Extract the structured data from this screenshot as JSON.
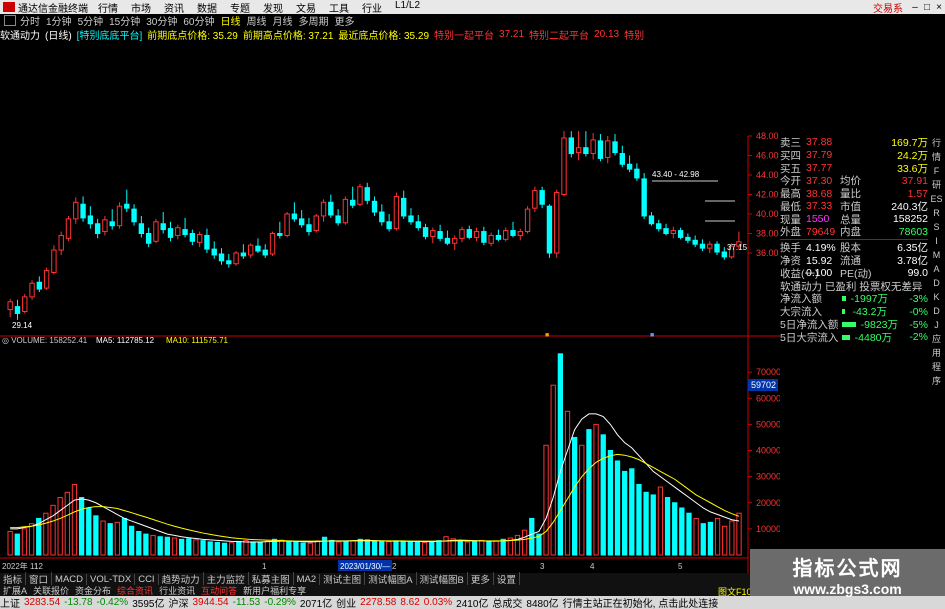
{
  "window": {
    "title": "通达信金融终端",
    "login": "交易系",
    "menu": [
      "行情",
      "市场",
      "资讯",
      "数据",
      "专题",
      "发现",
      "文易",
      "工具",
      "行业",
      "L1/L2"
    ]
  },
  "toolbar": {
    "periods": [
      "分时",
      "1分钟",
      "5分钟",
      "15分钟",
      "30分钟",
      "60分钟",
      "日线",
      "周线",
      "月线",
      "多周期",
      "更多"
    ],
    "active": "日线"
  },
  "infobar": {
    "name": "软通动力",
    "period_note": "(日线)",
    "items": [
      {
        "text": "[特别底底平台]",
        "color": "cyan"
      },
      {
        "text": "前期底点价格: 35.29",
        "color": "yellow"
      },
      {
        "text": "前期高点价格: 37.21",
        "color": "yellow"
      },
      {
        "text": "最近底点价格: 35.29",
        "color": "yellow"
      },
      {
        "text": "特别一起平台",
        "color": "red"
      },
      {
        "text": "37.21",
        "color": "red"
      },
      {
        "text": "特别二起平台",
        "color": "red"
      },
      {
        "text": "20.13",
        "color": "red"
      },
      {
        "text": "特别",
        "color": "red"
      }
    ]
  },
  "price_chart": {
    "ymin": 28,
    "ymax": 48,
    "y_ticks": [
      48.0,
      46.0,
      44.0,
      42.0,
      40.0,
      38.0,
      36.0
    ],
    "low_label": "29.14",
    "range_label": "43.40 - 42.98",
    "last_label": "37.15",
    "candles": [
      {
        "o": 30.2,
        "h": 31.3,
        "l": 29.4,
        "c": 31.0
      },
      {
        "o": 30.5,
        "h": 31.2,
        "l": 29.14,
        "c": 29.8
      },
      {
        "o": 30.0,
        "h": 31.8,
        "l": 29.8,
        "c": 31.5
      },
      {
        "o": 31.5,
        "h": 33.2,
        "l": 31.2,
        "c": 32.9
      },
      {
        "o": 33.0,
        "h": 33.6,
        "l": 32.0,
        "c": 32.3
      },
      {
        "o": 32.4,
        "h": 34.5,
        "l": 32.2,
        "c": 34.2
      },
      {
        "o": 34.0,
        "h": 36.8,
        "l": 33.8,
        "c": 36.3
      },
      {
        "o": 36.3,
        "h": 38.2,
        "l": 35.8,
        "c": 37.8
      },
      {
        "o": 37.5,
        "h": 39.8,
        "l": 37.2,
        "c": 39.5
      },
      {
        "o": 39.5,
        "h": 41.7,
        "l": 39.0,
        "c": 41.2
      },
      {
        "o": 41.0,
        "h": 41.8,
        "l": 39.2,
        "c": 39.6
      },
      {
        "o": 39.8,
        "h": 40.8,
        "l": 38.5,
        "c": 39.0
      },
      {
        "o": 39.0,
        "h": 39.5,
        "l": 37.5,
        "c": 38.0
      },
      {
        "o": 38.2,
        "h": 39.8,
        "l": 37.8,
        "c": 39.4
      },
      {
        "o": 39.2,
        "h": 40.5,
        "l": 38.4,
        "c": 38.8
      },
      {
        "o": 38.8,
        "h": 41.2,
        "l": 38.5,
        "c": 40.8
      },
      {
        "o": 41.0,
        "h": 42.5,
        "l": 40.2,
        "c": 40.6
      },
      {
        "o": 40.5,
        "h": 41.0,
        "l": 38.8,
        "c": 39.2
      },
      {
        "o": 39.0,
        "h": 39.8,
        "l": 37.6,
        "c": 38.0
      },
      {
        "o": 38.0,
        "h": 38.6,
        "l": 36.6,
        "c": 37.0
      },
      {
        "o": 37.2,
        "h": 39.5,
        "l": 37.0,
        "c": 39.2
      },
      {
        "o": 39.0,
        "h": 40.2,
        "l": 38.0,
        "c": 38.4
      },
      {
        "o": 38.5,
        "h": 39.2,
        "l": 37.2,
        "c": 37.6
      },
      {
        "o": 37.8,
        "h": 38.9,
        "l": 37.4,
        "c": 38.6
      },
      {
        "o": 38.4,
        "h": 39.6,
        "l": 37.6,
        "c": 37.9
      },
      {
        "o": 38.0,
        "h": 38.4,
        "l": 36.8,
        "c": 37.2
      },
      {
        "o": 37.1,
        "h": 38.2,
        "l": 36.6,
        "c": 37.9
      },
      {
        "o": 37.8,
        "h": 38.5,
        "l": 36.0,
        "c": 36.4
      },
      {
        "o": 36.4,
        "h": 37.2,
        "l": 35.4,
        "c": 35.8
      },
      {
        "o": 35.9,
        "h": 36.5,
        "l": 34.8,
        "c": 35.2
      },
      {
        "o": 35.2,
        "h": 35.9,
        "l": 34.5,
        "c": 34.9
      },
      {
        "o": 34.9,
        "h": 36.2,
        "l": 34.7,
        "c": 36.0
      },
      {
        "o": 36.0,
        "h": 36.9,
        "l": 35.4,
        "c": 35.7
      },
      {
        "o": 35.8,
        "h": 37.0,
        "l": 35.5,
        "c": 36.8
      },
      {
        "o": 36.7,
        "h": 37.5,
        "l": 36.0,
        "c": 36.2
      },
      {
        "o": 36.3,
        "h": 36.9,
        "l": 35.5,
        "c": 35.8
      },
      {
        "o": 35.9,
        "h": 38.2,
        "l": 35.7,
        "c": 38.0
      },
      {
        "o": 38.0,
        "h": 39.2,
        "l": 37.5,
        "c": 37.8
      },
      {
        "o": 37.8,
        "h": 40.2,
        "l": 37.6,
        "c": 40.0
      },
      {
        "o": 40.0,
        "h": 41.2,
        "l": 39.2,
        "c": 39.5
      },
      {
        "o": 39.5,
        "h": 40.4,
        "l": 38.6,
        "c": 38.9
      },
      {
        "o": 38.9,
        "h": 39.6,
        "l": 37.8,
        "c": 38.2
      },
      {
        "o": 38.3,
        "h": 40.0,
        "l": 38.1,
        "c": 39.8
      },
      {
        "o": 39.8,
        "h": 41.5,
        "l": 39.2,
        "c": 41.2
      },
      {
        "o": 41.2,
        "h": 42.0,
        "l": 39.6,
        "c": 39.9
      },
      {
        "o": 39.8,
        "h": 40.5,
        "l": 38.8,
        "c": 39.1
      },
      {
        "o": 39.1,
        "h": 41.8,
        "l": 38.9,
        "c": 41.5
      },
      {
        "o": 41.4,
        "h": 42.8,
        "l": 40.6,
        "c": 40.9
      },
      {
        "o": 41.0,
        "h": 43.1,
        "l": 40.8,
        "c": 42.8
      },
      {
        "o": 42.7,
        "h": 43.2,
        "l": 41.0,
        "c": 41.4
      },
      {
        "o": 41.3,
        "h": 41.8,
        "l": 39.8,
        "c": 40.2
      },
      {
        "o": 40.2,
        "h": 41.0,
        "l": 38.8,
        "c": 39.2
      },
      {
        "o": 39.2,
        "h": 40.0,
        "l": 38.2,
        "c": 38.5
      },
      {
        "o": 38.5,
        "h": 42.2,
        "l": 38.3,
        "c": 41.8
      },
      {
        "o": 41.6,
        "h": 42.4,
        "l": 39.5,
        "c": 39.8
      },
      {
        "o": 39.8,
        "h": 40.6,
        "l": 38.9,
        "c": 39.2
      },
      {
        "o": 39.2,
        "h": 39.9,
        "l": 38.3,
        "c": 38.6
      },
      {
        "o": 38.6,
        "h": 39.0,
        "l": 37.4,
        "c": 37.7
      },
      {
        "o": 37.7,
        "h": 38.6,
        "l": 37.0,
        "c": 38.3
      },
      {
        "o": 38.2,
        "h": 38.9,
        "l": 37.2,
        "c": 37.5
      },
      {
        "o": 37.5,
        "h": 38.3,
        "l": 36.8,
        "c": 37.0
      },
      {
        "o": 37.0,
        "h": 37.8,
        "l": 36.3,
        "c": 37.5
      },
      {
        "o": 37.5,
        "h": 38.7,
        "l": 37.1,
        "c": 38.4
      },
      {
        "o": 38.4,
        "h": 38.8,
        "l": 37.4,
        "c": 37.6
      },
      {
        "o": 37.6,
        "h": 38.6,
        "l": 37.2,
        "c": 38.2
      },
      {
        "o": 38.2,
        "h": 38.7,
        "l": 36.8,
        "c": 37.1
      },
      {
        "o": 37.0,
        "h": 38.1,
        "l": 36.7,
        "c": 37.8
      },
      {
        "o": 37.8,
        "h": 38.4,
        "l": 37.2,
        "c": 37.4
      },
      {
        "o": 37.4,
        "h": 38.6,
        "l": 37.2,
        "c": 38.3
      },
      {
        "o": 38.3,
        "h": 39.2,
        "l": 37.6,
        "c": 37.8
      },
      {
        "o": 37.8,
        "h": 38.5,
        "l": 37.3,
        "c": 38.2
      },
      {
        "o": 38.2,
        "h": 40.8,
        "l": 38.0,
        "c": 40.5
      },
      {
        "o": 40.6,
        "h": 42.8,
        "l": 40.2,
        "c": 42.4
      },
      {
        "o": 42.4,
        "h": 42.8,
        "l": 40.6,
        "c": 41.0
      },
      {
        "o": 40.8,
        "h": 41.0,
        "l": 35.5,
        "c": 36.0
      },
      {
        "o": 36.0,
        "h": 42.5,
        "l": 35.5,
        "c": 42.2
      },
      {
        "o": 42.0,
        "h": 48.5,
        "l": 41.8,
        "c": 47.8
      },
      {
        "o": 47.8,
        "h": 48.5,
        "l": 45.8,
        "c": 46.2
      },
      {
        "o": 46.3,
        "h": 48.5,
        "l": 45.5,
        "c": 46.8
      },
      {
        "o": 46.8,
        "h": 48.5,
        "l": 45.9,
        "c": 46.2
      },
      {
        "o": 46.2,
        "h": 48.3,
        "l": 45.6,
        "c": 47.6
      },
      {
        "o": 47.5,
        "h": 48.2,
        "l": 45.4,
        "c": 45.7
      },
      {
        "o": 45.8,
        "h": 48.0,
        "l": 45.2,
        "c": 47.5
      },
      {
        "o": 47.4,
        "h": 48.2,
        "l": 46.0,
        "c": 46.3
      },
      {
        "o": 46.2,
        "h": 47.0,
        "l": 44.8,
        "c": 45.1
      },
      {
        "o": 45.1,
        "h": 46.0,
        "l": 44.3,
        "c": 44.6
      },
      {
        "o": 44.6,
        "h": 45.2,
        "l": 43.4,
        "c": 43.7
      },
      {
        "o": 43.6,
        "h": 44.2,
        "l": 39.5,
        "c": 39.8
      },
      {
        "o": 39.8,
        "h": 40.2,
        "l": 38.8,
        "c": 39.0
      },
      {
        "o": 39.0,
        "h": 39.4,
        "l": 38.2,
        "c": 38.5
      },
      {
        "o": 38.5,
        "h": 39.0,
        "l": 37.8,
        "c": 38.0
      },
      {
        "o": 38.0,
        "h": 38.7,
        "l": 37.5,
        "c": 38.3
      },
      {
        "o": 38.3,
        "h": 38.6,
        "l": 37.4,
        "c": 37.6
      },
      {
        "o": 37.6,
        "h": 38.0,
        "l": 37.0,
        "c": 37.3
      },
      {
        "o": 37.3,
        "h": 37.8,
        "l": 36.6,
        "c": 36.9
      },
      {
        "o": 36.9,
        "h": 37.4,
        "l": 36.2,
        "c": 36.5
      },
      {
        "o": 36.5,
        "h": 37.2,
        "l": 36.0,
        "c": 36.9
      },
      {
        "o": 36.9,
        "h": 37.2,
        "l": 35.8,
        "c": 36.1
      },
      {
        "o": 36.1,
        "h": 36.6,
        "l": 35.3,
        "c": 35.6
      },
      {
        "o": 35.6,
        "h": 37.0,
        "l": 35.4,
        "c": 36.7
      },
      {
        "o": 36.7,
        "h": 38.2,
        "l": 36.4,
        "c": 37.15
      }
    ]
  },
  "volume_chart": {
    "header": {
      "label": "VOLUME: 158252.41",
      "ma5": "MA5: 112785.12",
      "ma10": "MA10: 111575.71"
    },
    "ymax": 80000,
    "y_ticks": [
      70000,
      60000,
      50000,
      40000,
      30000,
      20000,
      10000
    ],
    "current_tag": "59702",
    "date_tag": "2023/01/30/—",
    "x_labels": [
      "2022年 11",
      "12",
      "1",
      "2",
      "3",
      "4",
      "5"
    ],
    "values": [
      9000,
      8000,
      10000,
      12000,
      14000,
      16000,
      19000,
      22000,
      24000,
      27000,
      22000,
      18000,
      15000,
      13000,
      12000,
      12500,
      14000,
      11000,
      9000,
      8000,
      7500,
      7000,
      6800,
      6500,
      6000,
      6200,
      5800,
      5500,
      5000,
      4800,
      4500,
      4700,
      5200,
      5600,
      5000,
      4800,
      5300,
      6000,
      5700,
      5200,
      5000,
      4600,
      4500,
      5400,
      6800,
      5600,
      5000,
      5200,
      5400,
      6000,
      5800,
      5400,
      5000,
      5100,
      5400,
      5300,
      5200,
      5000,
      4800,
      5000,
      5500,
      7000,
      6200,
      5400,
      5000,
      5200,
      5600,
      5000,
      5300,
      6000,
      6500,
      7500,
      9500,
      14000,
      8000,
      42000,
      65000,
      77000,
      55000,
      45000,
      42000,
      48000,
      50000,
      46000,
      40000,
      36000,
      32000,
      33000,
      27000,
      24000,
      23000,
      26000,
      22000,
      20000,
      18000,
      16000,
      14000,
      12000,
      12500,
      14000,
      11000,
      13000,
      16000
    ],
    "ma_values": [
      10000,
      10000,
      10500,
      11000,
      12000,
      13500,
      15000,
      17000,
      19000,
      21000,
      21500,
      21000,
      20000,
      18500,
      17000,
      15500,
      14000,
      13000,
      12000,
      11000,
      10000,
      9000,
      8000,
      7500,
      7000,
      6600,
      6300,
      6000,
      5800,
      5600,
      5400,
      5200,
      5100,
      5000,
      5000,
      5000,
      5100,
      5200,
      5300,
      5300,
      5200,
      5100,
      5000,
      5100,
      5300,
      5400,
      5400,
      5400,
      5500,
      5600,
      5600,
      5500,
      5400,
      5300,
      5300,
      5300,
      5200,
      5200,
      5100,
      5100,
      5200,
      5400,
      5600,
      5700,
      5600,
      5500,
      5400,
      5300,
      5300,
      5400,
      5600,
      6000,
      6800,
      8000,
      9000,
      14000,
      22000,
      32000,
      40000,
      48000,
      52000,
      54000,
      54000,
      53000,
      50000,
      46000,
      43000,
      41000,
      38000,
      35000,
      32000,
      30000,
      28000,
      26000,
      24000,
      22000,
      20000,
      18000,
      16500,
      15500,
      14500,
      13500,
      13000
    ],
    "ma2_values": [
      10500,
      10500,
      10800,
      11000,
      11500,
      12200,
      13000,
      14000,
      15200,
      16500,
      17500,
      18200,
      18500,
      18500,
      18200,
      17800,
      17000,
      16200,
      15300,
      14500,
      13600,
      12700,
      11800,
      11000,
      10300,
      9600,
      9000,
      8400,
      7900,
      7400,
      7000,
      6600,
      6300,
      6100,
      5900,
      5800,
      5700,
      5600,
      5500,
      5400,
      5300,
      5300,
      5300,
      5300,
      5300,
      5300,
      5300,
      5300,
      5400,
      5400,
      5400,
      5400,
      5400,
      5400,
      5400,
      5400,
      5300,
      5300,
      5300,
      5300,
      5300,
      5300,
      5400,
      5400,
      5400,
      5400,
      5400,
      5400,
      5400,
      5400,
      5500,
      5700,
      6000,
      6500,
      7100,
      9000,
      12500,
      17000,
      21500,
      26000,
      30000,
      33000,
      35500,
      37000,
      38000,
      38500,
      38200,
      37500,
      36500,
      35000,
      33500,
      32000,
      30500,
      29000,
      27000,
      25000,
      23000,
      21500,
      20000,
      18500,
      17000,
      15800,
      14800
    ]
  },
  "quote": {
    "rows": [
      {
        "l1": "卖三",
        "v1": "37.88",
        "v1c": "red",
        "l2": "",
        "v2": "169.7万",
        "v2c": "yellow"
      },
      {
        "l1": "买四",
        "v1": "37.79",
        "v1c": "red",
        "l2": "",
        "v2": "24.2万",
        "v2c": "yellow"
      },
      {
        "l1": "买五",
        "v1": "37.77",
        "v1c": "red",
        "l2": "",
        "v2": "33.6万",
        "v2c": "yellow"
      },
      {
        "l1": "今开",
        "v1": "37.30",
        "v1c": "red",
        "l2": "均价",
        "v2": "37.91",
        "v2c": "red"
      },
      {
        "l1": "最高",
        "v1": "38.68",
        "v1c": "red",
        "l2": "量比",
        "v2": "1.57",
        "v2c": "red"
      },
      {
        "l1": "最低",
        "v1": "37.33",
        "v1c": "red",
        "l2": "市值",
        "v2": "240.3亿",
        "v2c": "white"
      },
      {
        "l1": "现量",
        "v1": "1550",
        "v1c": "magenta",
        "l2": "总量",
        "v2": "158252",
        "v2c": "white"
      },
      {
        "l1": "外盘",
        "v1": "79649",
        "v1c": "red",
        "l2": "内盘",
        "v2": "78603",
        "v2c": "green"
      }
    ],
    "rows2": [
      {
        "l1": "换手",
        "v1": "4.19%",
        "v1c": "white",
        "l2": "股本",
        "v2": "6.35亿",
        "v2c": "white"
      },
      {
        "l1": "净资",
        "v1": "15.92",
        "v1c": "white",
        "l2": "流通",
        "v2": "3.78亿",
        "v2c": "white"
      },
      {
        "l1": "收益(一)",
        "v1": "0.100",
        "v1c": "white",
        "l2": "PE(动)",
        "v2": "99.0",
        "v2c": "white"
      }
    ],
    "tags_line": "软通动力  已盈利  投票权无差异",
    "flows": [
      {
        "label": "净流入额",
        "bar": 4,
        "barc": "#33ff66",
        "val": "-1997万",
        "valc": "green",
        "pct": "-3%",
        "pctc": "green"
      },
      {
        "label": "大宗流入",
        "bar": 3,
        "barc": "#33ff66",
        "val": "-43.2万",
        "valc": "green",
        "pct": "-0%",
        "pctc": "green"
      },
      {
        "label": "5日净流入额",
        "bar": 14,
        "barc": "#33ff66",
        "val": "-9823万",
        "valc": "green",
        "pct": "-5%",
        "pctc": "green"
      },
      {
        "label": "5日大宗流入",
        "bar": 8,
        "barc": "#33ff66",
        "val": "-4480万",
        "valc": "green",
        "pct": "-2%",
        "pctc": "green"
      }
    ]
  },
  "side_tabs": [
    "行",
    "情",
    "F",
    "研",
    "ES",
    "R",
    "S",
    "I",
    "M",
    "A",
    "D",
    "K",
    "D",
    "J",
    "应",
    "用",
    "程",
    "序"
  ],
  "bottom_tabs": [
    "指标",
    "窗口",
    "MACD",
    "VOL-TDX",
    "CCI",
    "趋势动力",
    "主力监控",
    "私募主图",
    "MA2",
    "测试主图",
    "测试幅图A",
    "测试幅图B",
    "更多",
    "设置"
  ],
  "bottom_tabs2": [
    {
      "t": "扩展A",
      "c": "normal"
    },
    {
      "t": "关联报价",
      "c": "normal"
    },
    {
      "t": "资金分布",
      "c": "normal"
    },
    {
      "t": "综合资讯",
      "c": "red"
    },
    {
      "t": "行业资讯",
      "c": "normal"
    },
    {
      "t": "互动问答",
      "c": "red"
    },
    {
      "t": "新用户福利专享",
      "c": "normal"
    }
  ],
  "right_corner": {
    "t1": "图文F10",
    "t2": "模板"
  },
  "status": [
    {
      "t": "上证",
      "c": "black"
    },
    {
      "t": "3283.54",
      "c": "red"
    },
    {
      "t": "-13.78",
      "c": "green"
    },
    {
      "t": "-0.42%",
      "c": "green"
    },
    {
      "t": "3595亿",
      "c": "black"
    },
    {
      "t": "沪深",
      "c": "black"
    },
    {
      "t": "3944.54",
      "c": "red"
    },
    {
      "t": "-11.53",
      "c": "green"
    },
    {
      "t": "-0.29%",
      "c": "green"
    },
    {
      "t": "2071亿",
      "c": "black"
    },
    {
      "t": "创业",
      "c": "black"
    },
    {
      "t": "2278.58",
      "c": "red"
    },
    {
      "t": "8.62",
      "c": "red"
    },
    {
      "t": "0.03%",
      "c": "red"
    },
    {
      "t": "2410亿",
      "c": "black"
    },
    {
      "t": "总成交",
      "c": "black"
    },
    {
      "t": "8480亿",
      "c": "black"
    },
    {
      "t": "行情主站正在初始化, 点击此处连接",
      "c": "black"
    }
  ],
  "watermark": {
    "line1": "指标公式网",
    "line2": "www.zbgs3.com"
  }
}
